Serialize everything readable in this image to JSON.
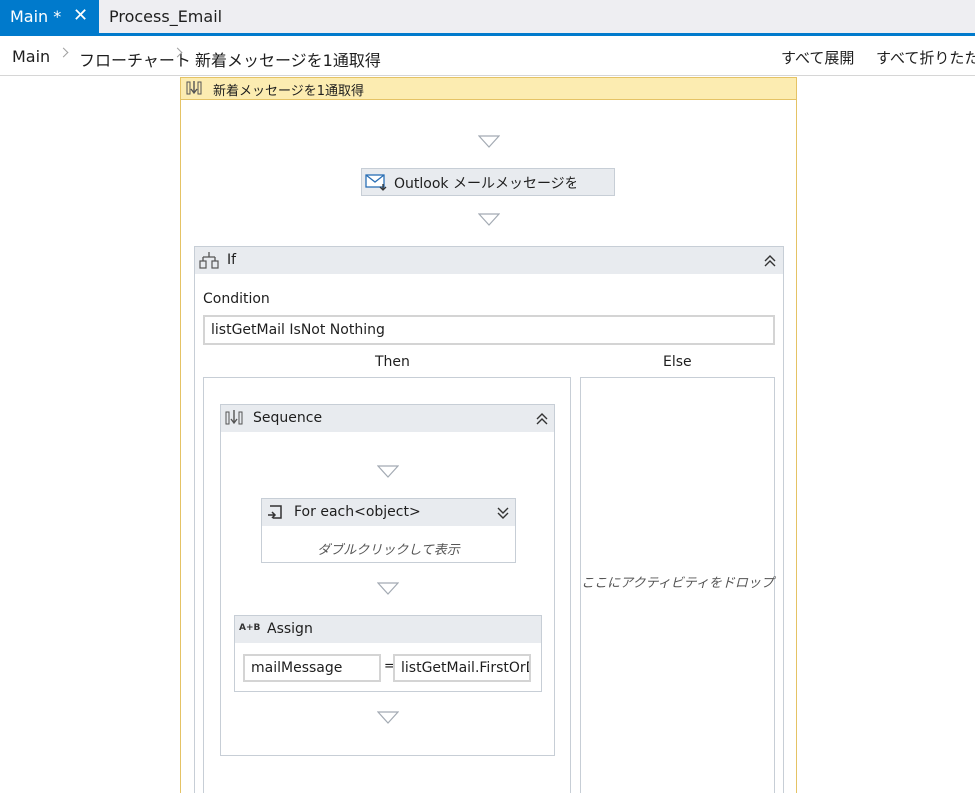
{
  "tabs": [
    {
      "label": "Main *",
      "active": true
    },
    {
      "label": "Process_Email",
      "active": false
    }
  ],
  "breadcrumb": {
    "items": [
      "Main",
      "フローチャート",
      "新着メッセージを1通取得"
    ],
    "expand_all": "すべて展開",
    "collapse_all": "すべて折りたた"
  },
  "designer": {
    "outer_sequence_title": "新着メッセージを1通取得",
    "outlook_activity": "Outlook メールメッセージを取得",
    "if": {
      "title": "If",
      "condition_label": "Condition",
      "condition_value": "listGetMail IsNot Nothing",
      "then_label": "Then",
      "else_label": "Else",
      "else_drop_hint": "ここにアクティビティをドロップ"
    },
    "sequence": {
      "title": "Sequence",
      "foreach_title": "For each<object>",
      "foreach_hint": "ダブルクリックして表示",
      "assign_title": "Assign",
      "assign_left": "mailMessage",
      "assign_eq": "=",
      "assign_right": "listGetMail.FirstOrDefault"
    }
  },
  "colors": {
    "tab_accent": "#007acc",
    "sequence_header": "#fcecb1",
    "activity_bg": "#e8ebef"
  }
}
